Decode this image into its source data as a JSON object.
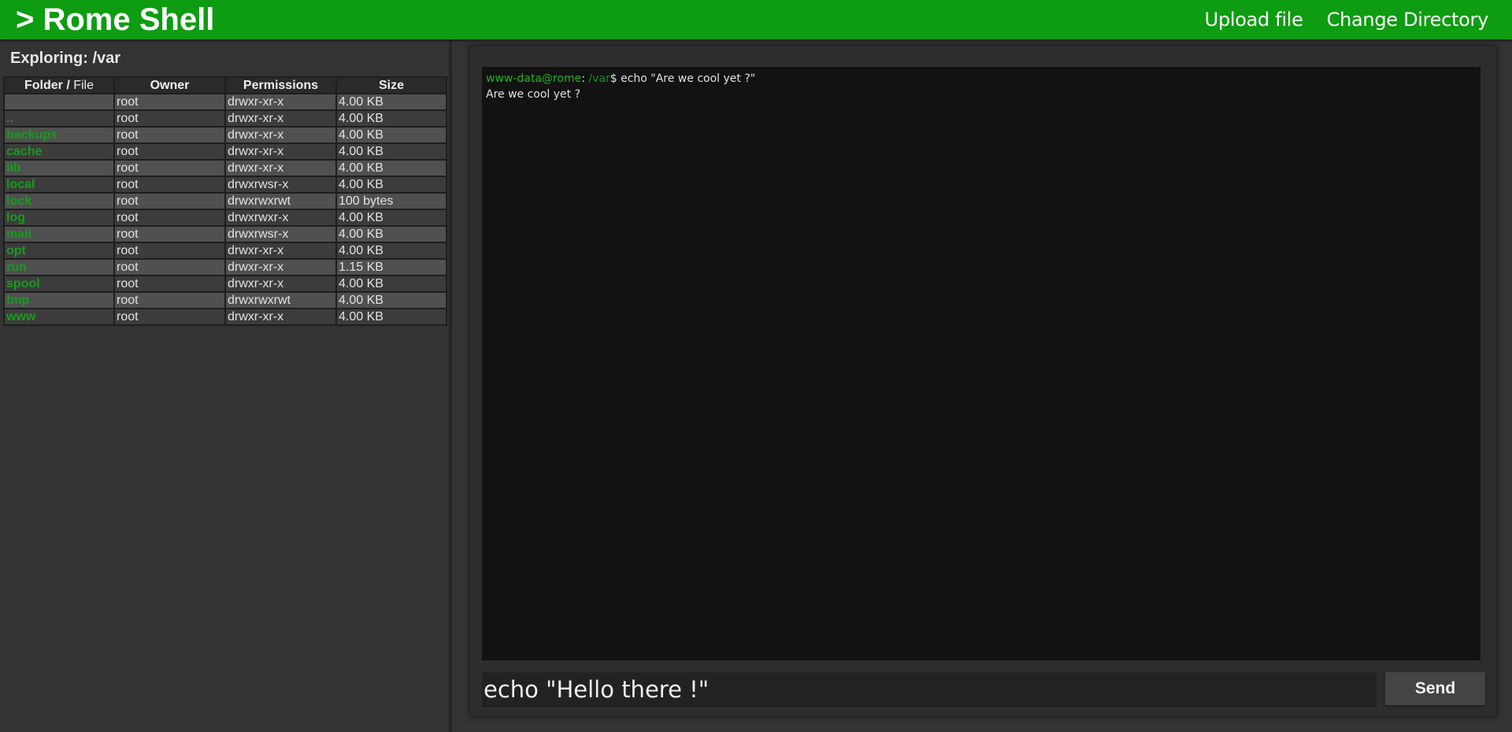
{
  "header": {
    "title": "> Rome Shell",
    "nav": [
      {
        "label": "Upload file"
      },
      {
        "label": "Change Directory"
      }
    ]
  },
  "explorer": {
    "title": "Exploring: /var",
    "columns": {
      "name_folder": "Folder /",
      "name_file": "File",
      "owner": "Owner",
      "permissions": "Permissions",
      "size": "Size"
    },
    "rows": [
      {
        "name": ".",
        "owner": "root",
        "permissions": "drwxr-xr-x",
        "size": "4.00 KB"
      },
      {
        "name": "..",
        "owner": "root",
        "permissions": "drwxr-xr-x",
        "size": "4.00 KB"
      },
      {
        "name": "backups",
        "owner": "root",
        "permissions": "drwxr-xr-x",
        "size": "4.00 KB"
      },
      {
        "name": "cache",
        "owner": "root",
        "permissions": "drwxr-xr-x",
        "size": "4.00 KB"
      },
      {
        "name": "lib",
        "owner": "root",
        "permissions": "drwxr-xr-x",
        "size": "4.00 KB"
      },
      {
        "name": "local",
        "owner": "root",
        "permissions": "drwxrwsr-x",
        "size": "4.00 KB"
      },
      {
        "name": "lock",
        "owner": "root",
        "permissions": "drwxrwxrwt",
        "size": "100 bytes"
      },
      {
        "name": "log",
        "owner": "root",
        "permissions": "drwxrwxr-x",
        "size": "4.00 KB"
      },
      {
        "name": "mail",
        "owner": "root",
        "permissions": "drwxrwsr-x",
        "size": "4.00 KB"
      },
      {
        "name": "opt",
        "owner": "root",
        "permissions": "drwxr-xr-x",
        "size": "4.00 KB"
      },
      {
        "name": "run",
        "owner": "root",
        "permissions": "drwxr-xr-x",
        "size": "1.15 KB"
      },
      {
        "name": "spool",
        "owner": "root",
        "permissions": "drwxr-xr-x",
        "size": "4.00 KB"
      },
      {
        "name": "tmp",
        "owner": "root",
        "permissions": "drwxrwxrwt",
        "size": "4.00 KB"
      },
      {
        "name": "www",
        "owner": "root",
        "permissions": "drwxr-xr-x",
        "size": "4.00 KB"
      }
    ]
  },
  "terminal": {
    "lines": [
      {
        "user": "www-data@rome",
        "sep": ": ",
        "path": "/var",
        "prompt": "$ ",
        "command": "echo \"Are we cool yet ?\""
      },
      {
        "output": "Are we cool yet ?"
      }
    ]
  },
  "input": {
    "value": "echo \"Hello there !\""
  },
  "send_button": {
    "label": "Send"
  },
  "colors": {
    "header_green": "#0e9c12",
    "link_green": "#169c1c",
    "background": "#333333",
    "terminal_bg": "#121212"
  }
}
